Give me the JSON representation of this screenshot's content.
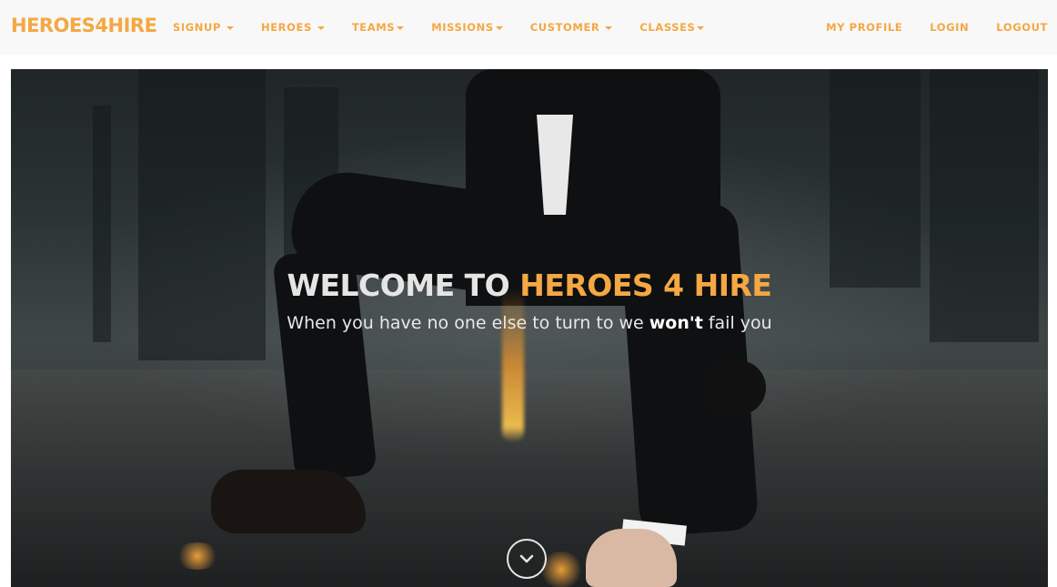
{
  "brand": "HEROES4HIRE",
  "nav_left": [
    {
      "label": "SIGNUP"
    },
    {
      "label": "HEROES"
    },
    {
      "label": "TEAMS"
    },
    {
      "label": "MISSIONS"
    },
    {
      "label": "CUSTOMER"
    },
    {
      "label": "CLASSES"
    }
  ],
  "nav_right": [
    {
      "label": "MY PROFILE"
    },
    {
      "label": "LOGIN"
    },
    {
      "label": "LOGOUT"
    }
  ],
  "hero": {
    "title_prefix": "WELCOME TO ",
    "title_accent": "HEROES 4 HIRE",
    "subtitle_before": "When you have no one else to turn to we ",
    "subtitle_bold": "won't",
    "subtitle_after": " fail you"
  },
  "icons": {
    "caret": "caret-down-icon",
    "scroll": "chevron-down-icon"
  },
  "colors": {
    "accent": "#f5a742",
    "navbar_bg": "#f8f8f8",
    "hero_text": "#e5e5e5"
  }
}
